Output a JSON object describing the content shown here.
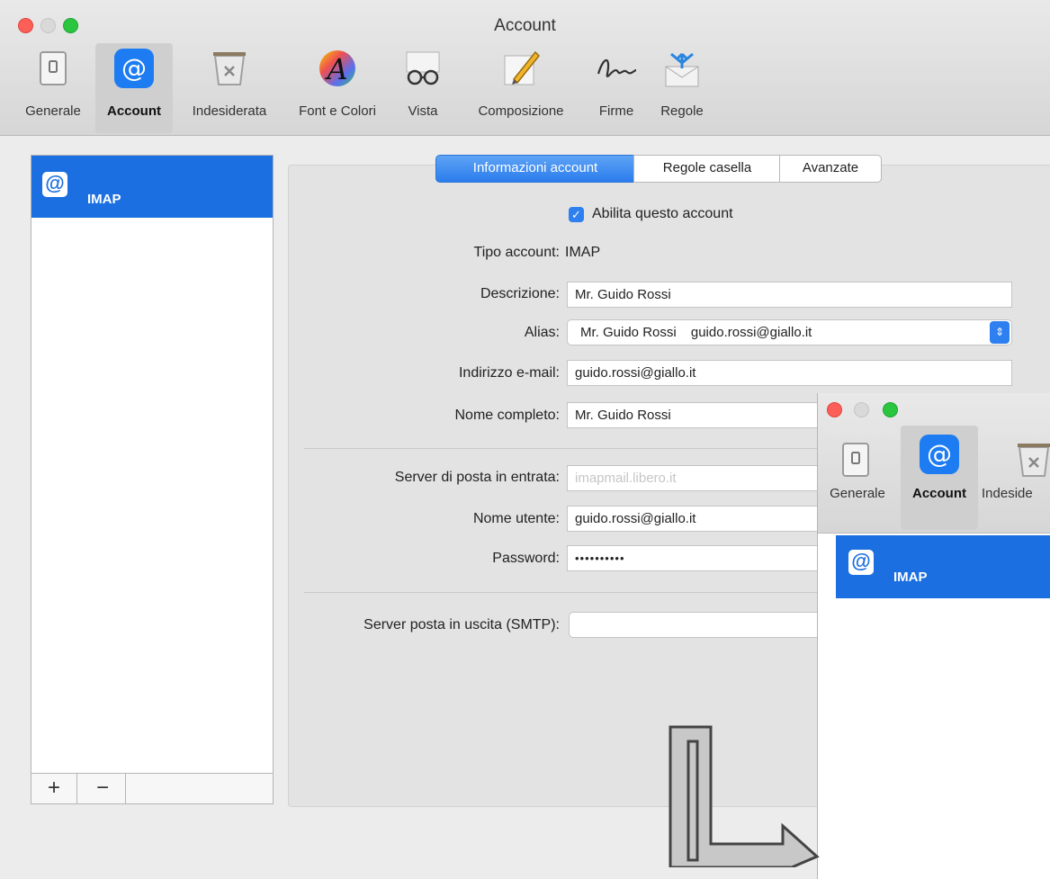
{
  "window": {
    "title": "Account"
  },
  "toolbar": {
    "items": [
      {
        "label": "Generale",
        "icon": "switch-icon"
      },
      {
        "label": "Account",
        "icon": "at-sign-icon",
        "selected": true
      },
      {
        "label": "Indesiderata",
        "icon": "trash-icon"
      },
      {
        "label": "Font e Colori",
        "icon": "font-color-icon"
      },
      {
        "label": "Vista",
        "icon": "glasses-icon"
      },
      {
        "label": "Composizione",
        "icon": "compose-pencil-icon"
      },
      {
        "label": "Firme",
        "icon": "signature-icon"
      },
      {
        "label": "Regole",
        "icon": "rules-envelope-icon"
      }
    ]
  },
  "sidebar": {
    "accounts": [
      {
        "icon": "at-sign-icon",
        "label": "IMAP"
      }
    ],
    "add_label": "+",
    "remove_label": "−"
  },
  "tabs": [
    {
      "label": "Informazioni account",
      "active": true
    },
    {
      "label": "Regole casella",
      "active": false
    },
    {
      "label": "Avanzate",
      "active": false
    }
  ],
  "form": {
    "enable_label": "Abilita questo account",
    "enabled": true,
    "type_label": "Tipo account:",
    "type_value": "IMAP",
    "description_label": "Descrizione:",
    "description_value": "Mr. Guido Rossi",
    "alias_label": "Alias:",
    "alias_name": "Mr. Guido Rossi",
    "alias_email": "guido.rossi@giallo.it",
    "email_label": "Indirizzo e-mail:",
    "email_value": "guido.rossi@giallo.it",
    "fullname_label": "Nome completo:",
    "fullname_value": "Mr. Guido Rossi",
    "incoming_label": "Server di posta in entrata:",
    "incoming_value": "imapmail.libero.it",
    "username_label": "Nome utente:",
    "username_value": "guido.rossi@giallo.it",
    "password_label": "Password:",
    "password_value": "••••••••••",
    "smtp_label": "Server posta in uscita (SMTP):",
    "smtp_value": ""
  },
  "overlay": {
    "toolbar": [
      {
        "label": "Generale"
      },
      {
        "label": "Account"
      },
      {
        "label": "Indeside"
      }
    ],
    "account_label": "IMAP"
  },
  "colors": {
    "accent": "#1b6fe0",
    "close": "#fc5f57",
    "min": "#d9d9d9",
    "zoom": "#2ac640"
  }
}
